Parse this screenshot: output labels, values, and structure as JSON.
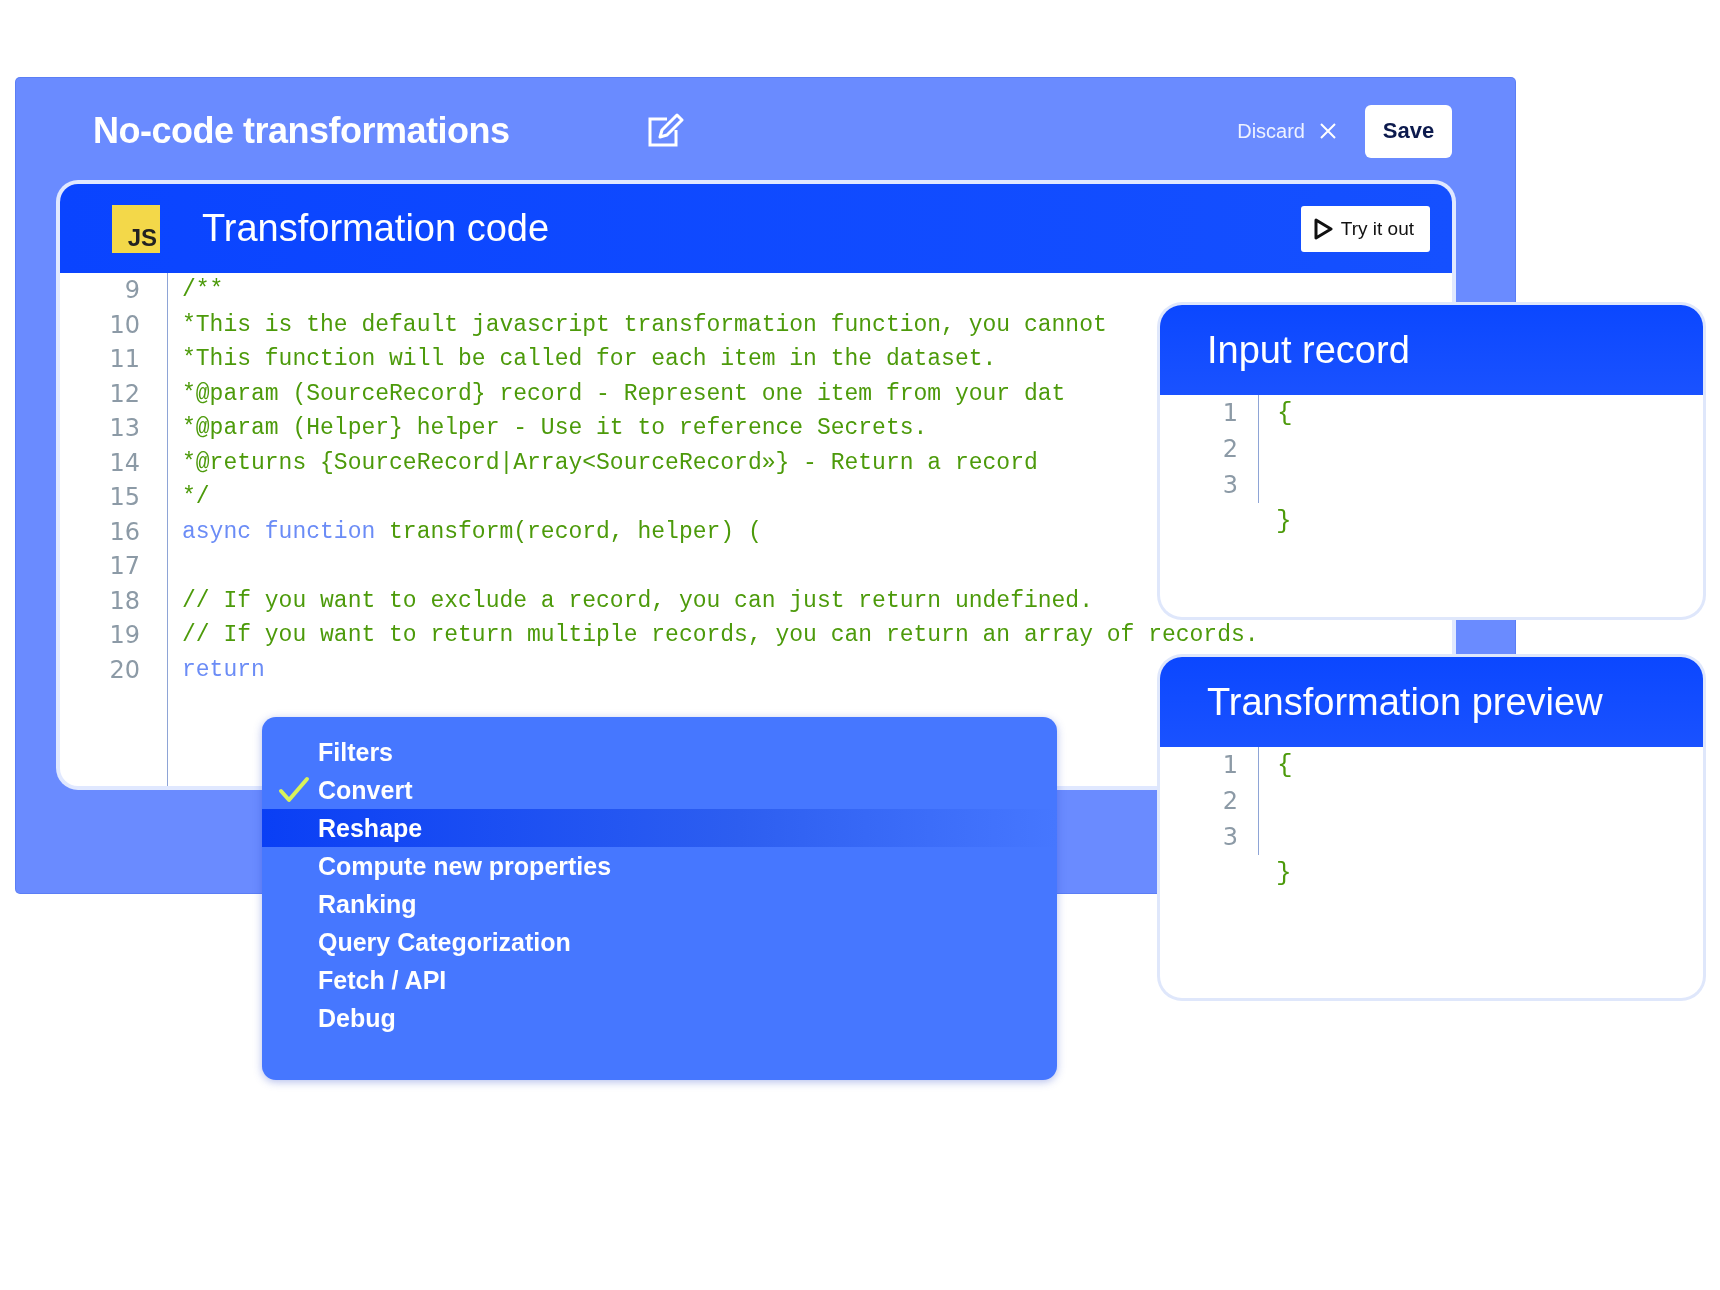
{
  "window": {
    "title": "No-code transformations",
    "discard": "Discard",
    "save": "Save"
  },
  "editor": {
    "logo": "JS",
    "title": "Transformation code",
    "run_button": "Try it out",
    "lines": [
      {
        "number": "9",
        "tokens": [
          {
            "kind": "text",
            "text": "/**"
          }
        ]
      },
      {
        "number": "10",
        "tokens": [
          {
            "kind": "text",
            "text": "*This is the default javascript transformation function, you cannot"
          }
        ]
      },
      {
        "number": "11",
        "tokens": [
          {
            "kind": "text",
            "text": "*This function will be called for each item in the dataset."
          }
        ]
      },
      {
        "number": "12",
        "tokens": [
          {
            "kind": "text",
            "text": "*@param (SourceRecord} record - Represent one item from your dat"
          }
        ]
      },
      {
        "number": "13",
        "tokens": [
          {
            "kind": "text",
            "text": "*@param (Helper} helper - Use it to reference Secrets."
          }
        ]
      },
      {
        "number": "14",
        "tokens": [
          {
            "kind": "text",
            "text": "*@returns {SourceRecord|Array<SourceRecord»} - Return a record"
          }
        ]
      },
      {
        "number": "15",
        "tokens": [
          {
            "kind": "text",
            "text": "*/"
          }
        ]
      },
      {
        "number": "16",
        "tokens": [
          {
            "kind": "keyword",
            "text": "async function"
          },
          {
            "kind": "text",
            "text": " transform(record, helper) ("
          }
        ]
      },
      {
        "number": "17"
      },
      {
        "number": "18",
        "tokens": [
          {
            "kind": "text",
            "text": "// If you want to exclude a record, you can just return undefined."
          }
        ]
      },
      {
        "number": "19",
        "tokens": [
          {
            "kind": "text",
            "text": "// If you want to return multiple records, you can return an array of records."
          }
        ]
      },
      {
        "number": "20",
        "tokens": [
          {
            "kind": "keyword",
            "text": "return"
          }
        ]
      }
    ]
  },
  "menu": {
    "items": [
      {
        "label": "Filters",
        "checked": false,
        "selected": false
      },
      {
        "label": "Convert",
        "checked": true,
        "selected": false
      },
      {
        "label": "Reshape",
        "checked": false,
        "selected": true
      },
      {
        "label": "Compute new properties",
        "checked": false,
        "selected": false
      },
      {
        "label": "Ranking",
        "checked": false,
        "selected": false
      },
      {
        "label": "Query Categorization",
        "checked": false,
        "selected": false
      },
      {
        "label": "Fetch / API",
        "checked": false,
        "selected": false
      },
      {
        "label": "Debug",
        "checked": false,
        "selected": false
      }
    ]
  },
  "panels": [
    {
      "title": "Input record",
      "lines": [
        {
          "number": "1",
          "code": "{"
        },
        {
          "number": "2"
        },
        {
          "number": "3"
        },
        {
          "code": "}"
        }
      ]
    },
    {
      "title": "Transformation preview",
      "lines": [
        {
          "number": "1",
          "code": "{"
        },
        {
          "number": "2"
        },
        {
          "number": "3"
        },
        {
          "code": "}"
        }
      ]
    }
  ]
}
